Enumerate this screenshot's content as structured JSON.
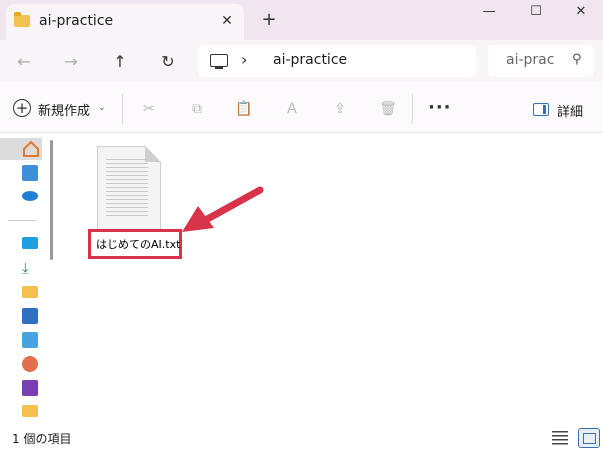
{
  "tab": {
    "title": "ai-practice",
    "close_glyph": "✕",
    "new_tab_glyph": "+"
  },
  "window": {
    "minimize": "—",
    "maximize": "☐",
    "close": "✕"
  },
  "nav": {
    "back": "←",
    "forward": "→",
    "up": "↑",
    "refresh": "↻"
  },
  "address": {
    "separator": "›",
    "path": "ai-practice"
  },
  "search": {
    "placeholder": "ai-prac",
    "icon": "⚲"
  },
  "toolbar": {
    "new_plus": "+",
    "new_label": "新規作成",
    "new_caret": "⌄",
    "cut": "✂",
    "copy": "⧉",
    "paste": "📋",
    "rename": "Ａ",
    "share": "⇪",
    "delete": "🗑",
    "more": "···",
    "details_label": "詳細"
  },
  "file": {
    "name": "はじめてのAI.txt"
  },
  "status": {
    "item_count": "1 個の項目"
  },
  "colors": {
    "highlight": "#d9334a",
    "accent": "#3a6fb0",
    "tabbar": "#efe6f0"
  }
}
